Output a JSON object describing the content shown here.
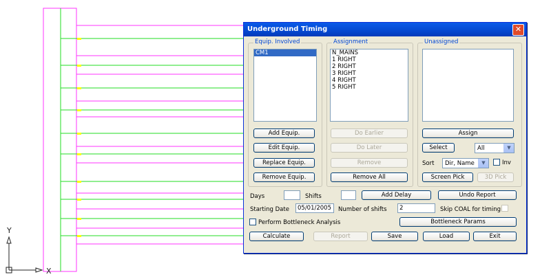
{
  "window": {
    "title": "Underground Timing"
  },
  "equip_group": {
    "title": "Equip. Involved",
    "items": [
      "CM1"
    ],
    "selected_index": 0
  },
  "assign_group": {
    "title": "Assignment",
    "items": [
      "N_MAINS",
      "1 RIGHT",
      "2 RIGHT",
      "3 RIGHT",
      "4 RIGHT",
      "5 RIGHT"
    ]
  },
  "unassigned_group": {
    "title": "Unassigned",
    "items": []
  },
  "buttons": {
    "add_equip": "Add Equip.",
    "edit_equip": "Edit Equip.",
    "replace_equip": "Replace Equip.",
    "remove_equip": "Remove Equip.",
    "do_earlier": "Do Earlier",
    "do_later": "Do Later",
    "remove": "Remove",
    "remove_all": "Remove All",
    "assign": "Assign",
    "select": "Select",
    "screen_pick": "Screen Pick",
    "pick_3d": "3D Pick",
    "add_delay": "Add Delay",
    "undo_report": "Undo Report",
    "bottleneck_params": "Bottleneck Params",
    "calculate": "Calculate",
    "report": "Report",
    "save": "Save",
    "load": "Load",
    "exit": "Exit"
  },
  "select_combo": {
    "value": "All"
  },
  "sort": {
    "label": "Sort",
    "value": "Dir, Name",
    "inv_label": "Inv"
  },
  "fields": {
    "days_label": "Days",
    "days_value": "",
    "shifts_label": "Shifts",
    "shifts_value": "",
    "starting_date_label": "Starting Date",
    "starting_date_value": "05/01/2005",
    "num_shifts_label": "Number of shifts",
    "num_shifts_value": "2",
    "skip_coal_label": "Skip COAL for timing",
    "bottleneck_label": "Perform Bottleneck Analysis"
  },
  "axes": {
    "y": "Y",
    "x": "X"
  },
  "colors": {
    "magenta": "#ff33ff",
    "green": "#22dd22",
    "yellow": "#ffff00",
    "titlebar": "#0548d0"
  }
}
